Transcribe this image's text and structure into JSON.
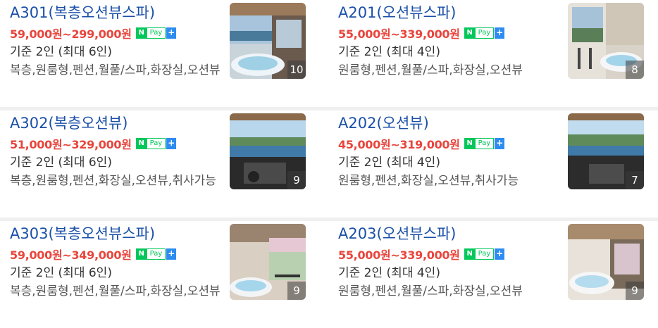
{
  "rooms": [
    {
      "title": "A301(복층오션뷰스파)",
      "price": "59,000원~299,000원",
      "capacity": "기준 2인 (최대 6인)",
      "features": "복층,원룸형,펜션,월풀/스파,화장실,오션뷰",
      "photo_count": "10"
    },
    {
      "title": "A201(오션뷰스파)",
      "price": "55,000원~339,000원",
      "capacity": "기준 2인 (최대 4인)",
      "features": "원룸형,펜션,월풀/스파,화장실,오션뷰",
      "photo_count": "8"
    },
    {
      "title": "A302(복층오션뷰)",
      "price": "51,000원~329,000원",
      "capacity": "기준 2인 (최대 6인)",
      "features": "복층,원룸형,펜션,화장실,오션뷰,취사가능",
      "photo_count": "9"
    },
    {
      "title": "A202(오션뷰)",
      "price": "45,000원~319,000원",
      "capacity": "기준 2인 (최대 4인)",
      "features": "원룸형,펜션,화장실,오션뷰,취사가능",
      "photo_count": "7"
    },
    {
      "title": "A303(복층오션뷰스파)",
      "price": "59,000원~349,000원",
      "capacity": "기준 2인 (최대 6인)",
      "features": "복층,원룸형,펜션,월풀/스파,화장실,오션뷰",
      "photo_count": "9"
    },
    {
      "title": "A203(오션뷰스파)",
      "price": "55,000원~339,000원",
      "capacity": "기준 2인 (최대 4인)",
      "features": "원룸형,펜션,월풀/스파,화장실,오션뷰",
      "photo_count": "9"
    }
  ],
  "npay": {
    "n": "N",
    "pay": "Pay",
    "plus": "+"
  },
  "colors": {
    "title": "#1a4fa8",
    "price": "#e8453c",
    "npay_green": "#03c75a",
    "npay_plus": "#2d8cf0"
  },
  "icons": {
    "payment": "naver-pay-icon"
  }
}
